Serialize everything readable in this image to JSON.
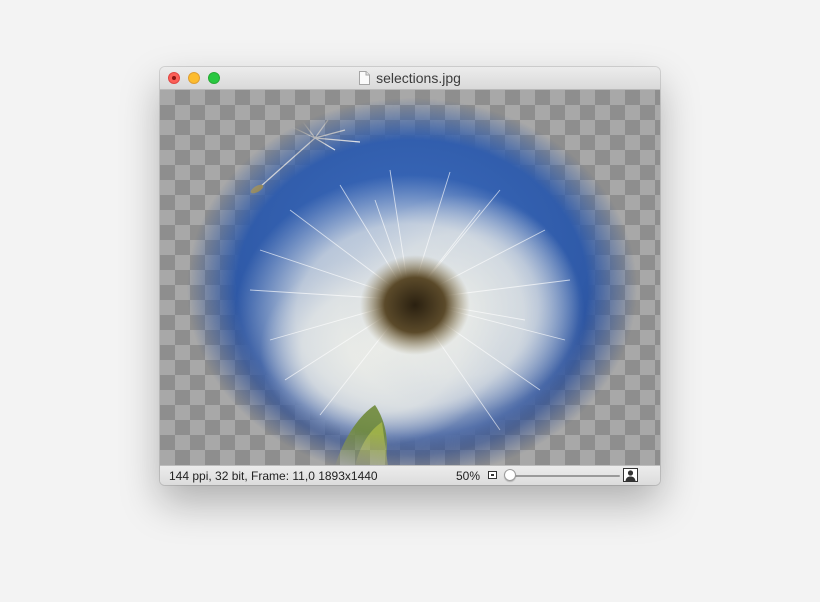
{
  "window": {
    "title": "selections.jpg",
    "buttons": [
      "close",
      "minimize",
      "zoom"
    ]
  },
  "canvas": {
    "image_subject": "dandelion seed head on blue sky with feathered elliptical selection over transparency checkerboard"
  },
  "statusbar": {
    "info": "144 ppi, 32 bit, Frame: 11,0 1893x1440",
    "zoom": "50%",
    "zoom_level": 0.0
  },
  "colors": {
    "sky": "#2f5aa8",
    "close": "#fc5f57",
    "minimize": "#fdbc2e",
    "maximize": "#28c840"
  }
}
